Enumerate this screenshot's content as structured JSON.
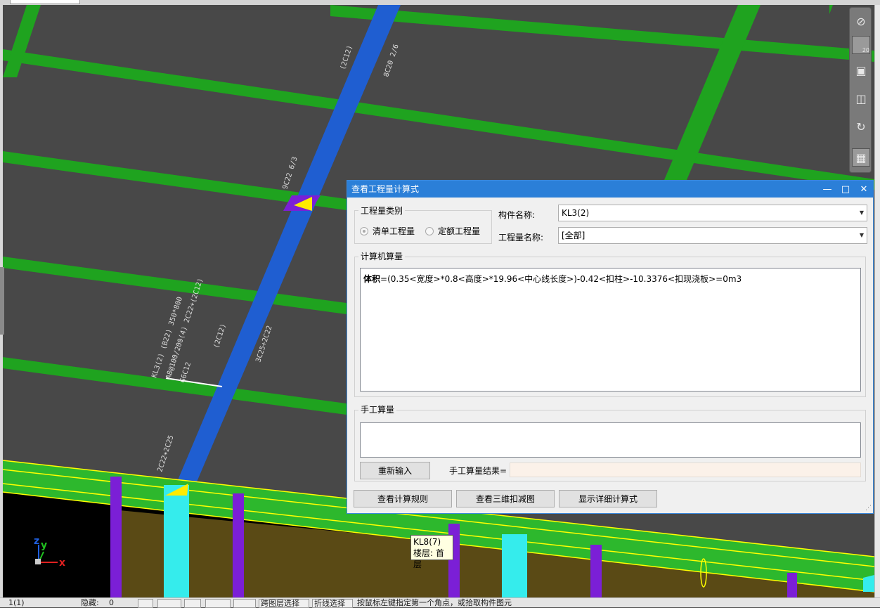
{
  "viewport": {
    "annotations": [
      "(2C12)",
      "8C20 2/6",
      "9C22 6/3",
      "KL3(2) (B22) 350*800",
      "A8@100/200(4) 2C22+(2C12)",
      "G6C12",
      "(2C12)",
      "3C25+2C22",
      "2C22+2C25"
    ],
    "axis": {
      "x": "x",
      "y": "y",
      "z": "z"
    },
    "nav_scale": "20"
  },
  "tooltip": {
    "line1": "KL8(7)",
    "line2": "楼层: 首层"
  },
  "dialog": {
    "title": "查看工程量计算式",
    "controls": {
      "minimize": "—",
      "maximize": "□",
      "close": "✕"
    },
    "category_group": {
      "legend": "工程量类别",
      "option1": "清单工程量",
      "option2": "定额工程量",
      "selected": "清单工程量"
    },
    "component_label": "构件名称:",
    "component_value": "KL3(2)",
    "quantity_label": "工程量名称:",
    "quantity_value": "[全部]",
    "computer_group": {
      "legend": "计算机算量",
      "formula_bold": "体积",
      "formula_rest": "=(0.35<宽度>*0.8<高度>*19.96<中心线长度>)-0.42<扣柱>-10.3376<扣现浇板>=0m3"
    },
    "manual_group": {
      "legend": "手工算量",
      "reinput_button": "重新输入",
      "result_label": "手工算量结果=",
      "result_value": ""
    },
    "buttons": {
      "rules": "查看计算规则",
      "view3d": "查看三维扣减图",
      "detail": "显示详细计算式"
    }
  },
  "statusbar": {
    "page": "1(1)",
    "hide_label": "隐藏:",
    "hide_value": "0",
    "cross_layer": "跨图层选择",
    "polyline_select": "折线选择",
    "hint": "按鼠标左键指定第一个角点，或拾取构件图元"
  }
}
